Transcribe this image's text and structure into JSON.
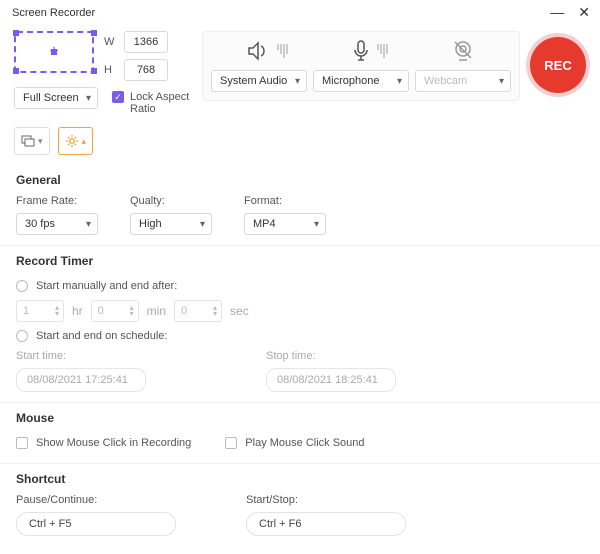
{
  "window": {
    "title": "Screen Recorder"
  },
  "region": {
    "mode": "Full Screen",
    "width": "1366",
    "height": "768",
    "w_label": "W",
    "h_label": "H",
    "lock_label": "Lock Aspect Ratio",
    "lock_checked": true
  },
  "sources": {
    "audio": "System Audio",
    "mic": "Microphone",
    "webcam": "Webcam"
  },
  "rec": {
    "label": "REC"
  },
  "general": {
    "title": "General",
    "frame_rate_label": "Frame Rate:",
    "frame_rate": "30 fps",
    "quality_label": "Qualty:",
    "quality": "High",
    "format_label": "Format:",
    "format": "MP4"
  },
  "timer": {
    "title": "Record Timer",
    "opt_manual": "Start manually and end after:",
    "hr": "1",
    "hr_unit": "hr",
    "min": "0",
    "min_unit": "min",
    "sec": "0",
    "sec_unit": "sec",
    "opt_schedule": "Start and end on schedule:",
    "start_label": "Start time:",
    "start_value": "08/08/2021 17:25:41",
    "stop_label": "Stop time:",
    "stop_value": "08/08/2021 18:25:41"
  },
  "mouse": {
    "title": "Mouse",
    "show_click": "Show Mouse Click in Recording",
    "play_sound": "Play Mouse Click Sound"
  },
  "shortcut": {
    "title": "Shortcut",
    "pause_label": "Pause/Continue:",
    "pause_value": "Ctrl + F5",
    "startstop_label": "Start/Stop:",
    "startstop_value": "Ctrl + F6"
  }
}
